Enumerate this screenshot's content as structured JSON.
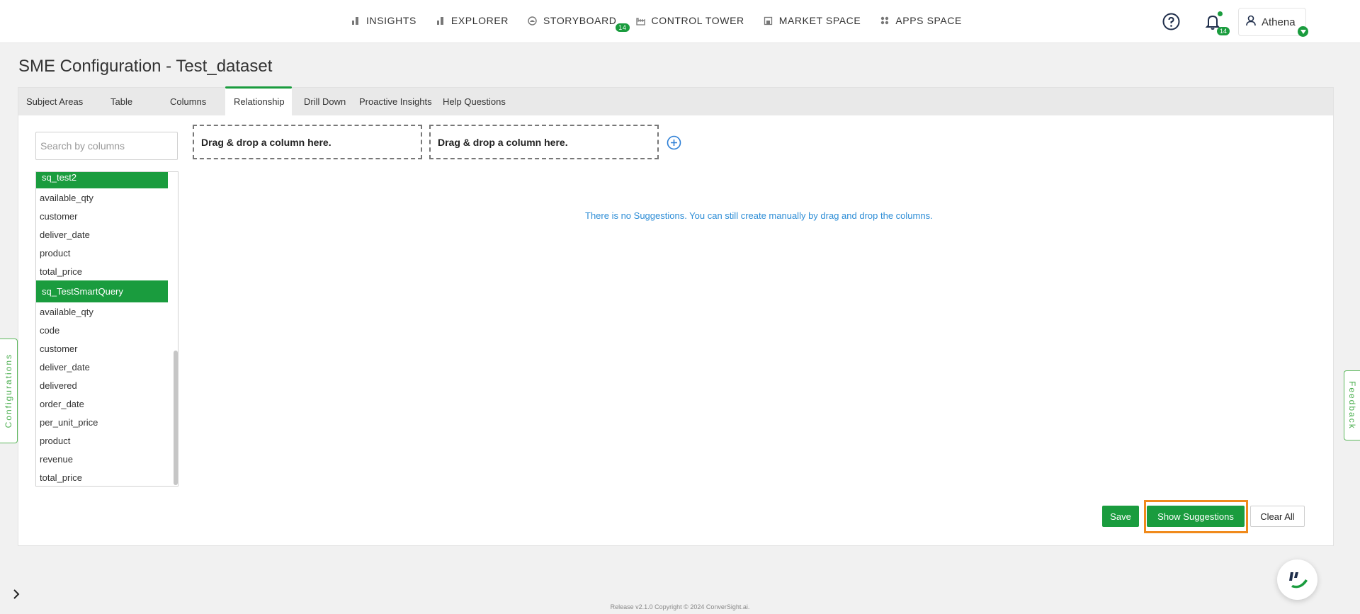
{
  "nav": {
    "items": [
      {
        "label": "INSIGHTS",
        "icon": "bar-chart-icon"
      },
      {
        "label": "EXPLORER",
        "icon": "bar-chart-icon"
      },
      {
        "label": "STORYBOARD",
        "icon": "storyboard-icon",
        "badge": "14"
      },
      {
        "label": "CONTROL TOWER",
        "icon": "factory-icon"
      },
      {
        "label": "MARKET SPACE",
        "icon": "store-icon"
      },
      {
        "label": "APPS SPACE",
        "icon": "grid-icon"
      }
    ],
    "notification_badge": "14",
    "user_name": "Athena"
  },
  "page": {
    "title": "SME Configuration - Test_dataset"
  },
  "tabs": [
    {
      "label": "Subject Areas"
    },
    {
      "label": "Table"
    },
    {
      "label": "Columns"
    },
    {
      "label": "Relationship",
      "active": true
    },
    {
      "label": "Drill Down"
    },
    {
      "label": "Proactive Insights"
    },
    {
      "label": "Help Questions"
    }
  ],
  "search": {
    "placeholder": "Search by columns"
  },
  "column_groups": [
    {
      "name": "sq_test2",
      "columns": [
        "available_qty",
        "customer",
        "deliver_date",
        "product",
        "total_price"
      ]
    },
    {
      "name": "sq_TestSmartQuery",
      "columns": [
        "available_qty",
        "code",
        "customer",
        "deliver_date",
        "delivered",
        "order_date",
        "per_unit_price",
        "product",
        "revenue",
        "total_price"
      ]
    }
  ],
  "drop_zones": {
    "left": "Drag & drop a column here.",
    "right": "Drag & drop a column here."
  },
  "message": "There is no Suggestions. You can still create manually by drag and drop the columns.",
  "buttons": {
    "save": "Save",
    "show_suggestions": "Show Suggestions",
    "clear_all": "Clear All"
  },
  "side_tabs": {
    "left": "Configurations",
    "right": "Feedback"
  },
  "footer": "Release v2.1.0 Copyright © 2024 ConverSight.ai.",
  "colors": {
    "brand_green": "#1a9c3e",
    "link_blue": "#2d8dd6",
    "highlight_orange": "#f08a1c"
  }
}
